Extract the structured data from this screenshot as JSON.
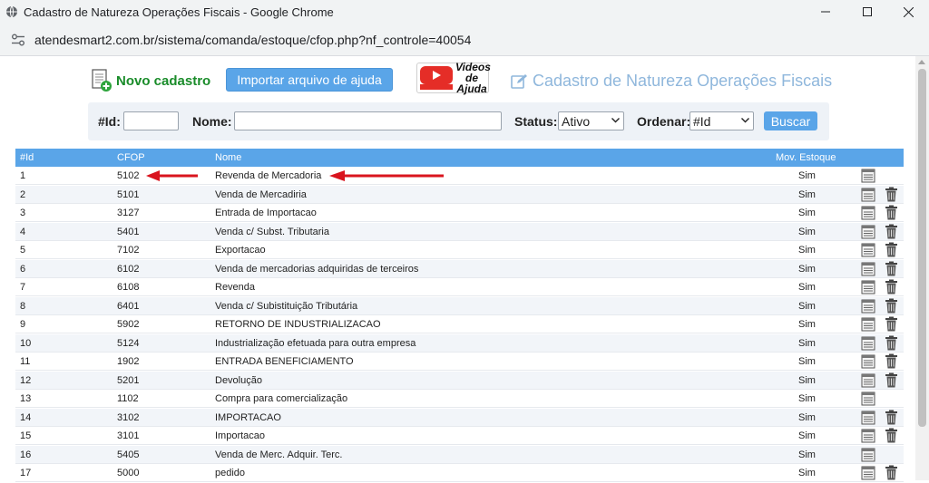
{
  "window": {
    "title": "Cadastro de Natureza Operações Fiscais - Google Chrome",
    "url": "atendesmart2.com.br/sistema/comanda/estoque/cfop.php?nf_controle=40054"
  },
  "toolbar": {
    "novo_cadastro": "Novo cadastro",
    "importar": "Importar arquivo de ajuda",
    "videos": "Videos de Ajuda",
    "page_title": "Cadastro de Natureza Operações Fiscais"
  },
  "filters": {
    "id_label": "#Id:",
    "id_value": "",
    "nome_label": "Nome:",
    "nome_value": "",
    "status_label": "Status:",
    "status_value": "Ativo",
    "ordenar_label": "Ordenar:",
    "ordenar_value": "#Id",
    "buscar": "Buscar"
  },
  "table": {
    "headers": {
      "id": "#Id",
      "cfop": "CFOP",
      "nome": "Nome",
      "mov": "Mov. Estoque"
    },
    "rows": [
      {
        "id": "1",
        "cfop": "5102",
        "nome": "Revenda de Mercadoria",
        "mov": "Sim",
        "delete": false
      },
      {
        "id": "2",
        "cfop": "5101",
        "nome": "Venda de Mercadiria",
        "mov": "Sim",
        "delete": true
      },
      {
        "id": "3",
        "cfop": "3127",
        "nome": "Entrada de Importacao",
        "mov": "Sim",
        "delete": true
      },
      {
        "id": "4",
        "cfop": "5401",
        "nome": "Venda c/ Subst. Tributaria",
        "mov": "Sim",
        "delete": true
      },
      {
        "id": "5",
        "cfop": "7102",
        "nome": "Exportacao",
        "mov": "Sim",
        "delete": true
      },
      {
        "id": "6",
        "cfop": "6102",
        "nome": "Venda de mercadorias adquiridas de terceiros",
        "mov": "Sim",
        "delete": true
      },
      {
        "id": "7",
        "cfop": "6108",
        "nome": "Revenda",
        "mov": "Sim",
        "delete": true
      },
      {
        "id": "8",
        "cfop": "6401",
        "nome": "Venda c/ Subistituição Tributária",
        "mov": "Sim",
        "delete": true
      },
      {
        "id": "9",
        "cfop": "5902",
        "nome": "RETORNO DE INDUSTRIALIZACAO",
        "mov": "Sim",
        "delete": true
      },
      {
        "id": "10",
        "cfop": "5124",
        "nome": "Industrialização efetuada para outra empresa",
        "mov": "Sim",
        "delete": true
      },
      {
        "id": "11",
        "cfop": "1902",
        "nome": "ENTRADA BENEFICIAMENTO",
        "mov": "Sim",
        "delete": true
      },
      {
        "id": "12",
        "cfop": "5201",
        "nome": "Devolução",
        "mov": "Sim",
        "delete": true
      },
      {
        "id": "13",
        "cfop": "1102",
        "nome": "Compra para comercialização",
        "mov": "Sim",
        "delete": false
      },
      {
        "id": "14",
        "cfop": "3102",
        "nome": "IMPORTACAO",
        "mov": "Sim",
        "delete": true
      },
      {
        "id": "15",
        "cfop": "3101",
        "nome": "Importacao",
        "mov": "Sim",
        "delete": true
      },
      {
        "id": "16",
        "cfop": "5405",
        "nome": "Venda de Merc. Adquir. Terc.",
        "mov": "Sim",
        "delete": false
      },
      {
        "id": "17",
        "cfop": "5000",
        "nome": "pedido",
        "mov": "Sim",
        "delete": true
      }
    ]
  },
  "colors": {
    "accent": "#5aa5e8",
    "novo_green": "#1a8c2a",
    "title_blue": "#8fb7dc",
    "annotation_red": "#d9141e"
  },
  "icons": {
    "favicon": "globe-icon",
    "site_settings": "tune-icon",
    "edit": "list-edit-icon",
    "delete": "trash-icon",
    "title": "edit-square-icon"
  }
}
